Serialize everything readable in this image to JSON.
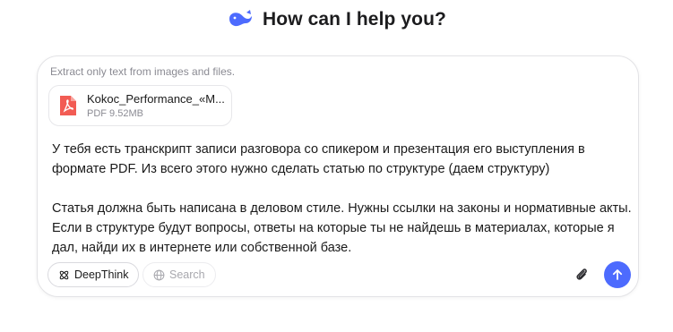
{
  "header": {
    "title": "How can I help you?",
    "logo_icon": "whale-logo-icon"
  },
  "composer": {
    "hint": "Extract only text from images and files.",
    "attachment": {
      "name": "Kokoc_Performance_«M...",
      "meta": "PDF 9.52MB",
      "icon": "pdf-file-icon"
    },
    "message": {
      "paragraph1": "У тебя есть транскрипт записи разговора со спикером и презентация его выступления в формате PDF. Из всего этого нужно сделать статью по структуре (даем структуру)",
      "paragraph2": "Статья должна быть написана в деловом стиле. Нужны ссылки на законы и нормативные акты. Если в структуре будут вопросы, ответы на которые ты не найдешь в материалах, которые я дал, найди их в интернете или собственной базе."
    },
    "deepthink_label": "DeepThink",
    "search_label": "Search",
    "accent_color": "#4d6bfe"
  }
}
